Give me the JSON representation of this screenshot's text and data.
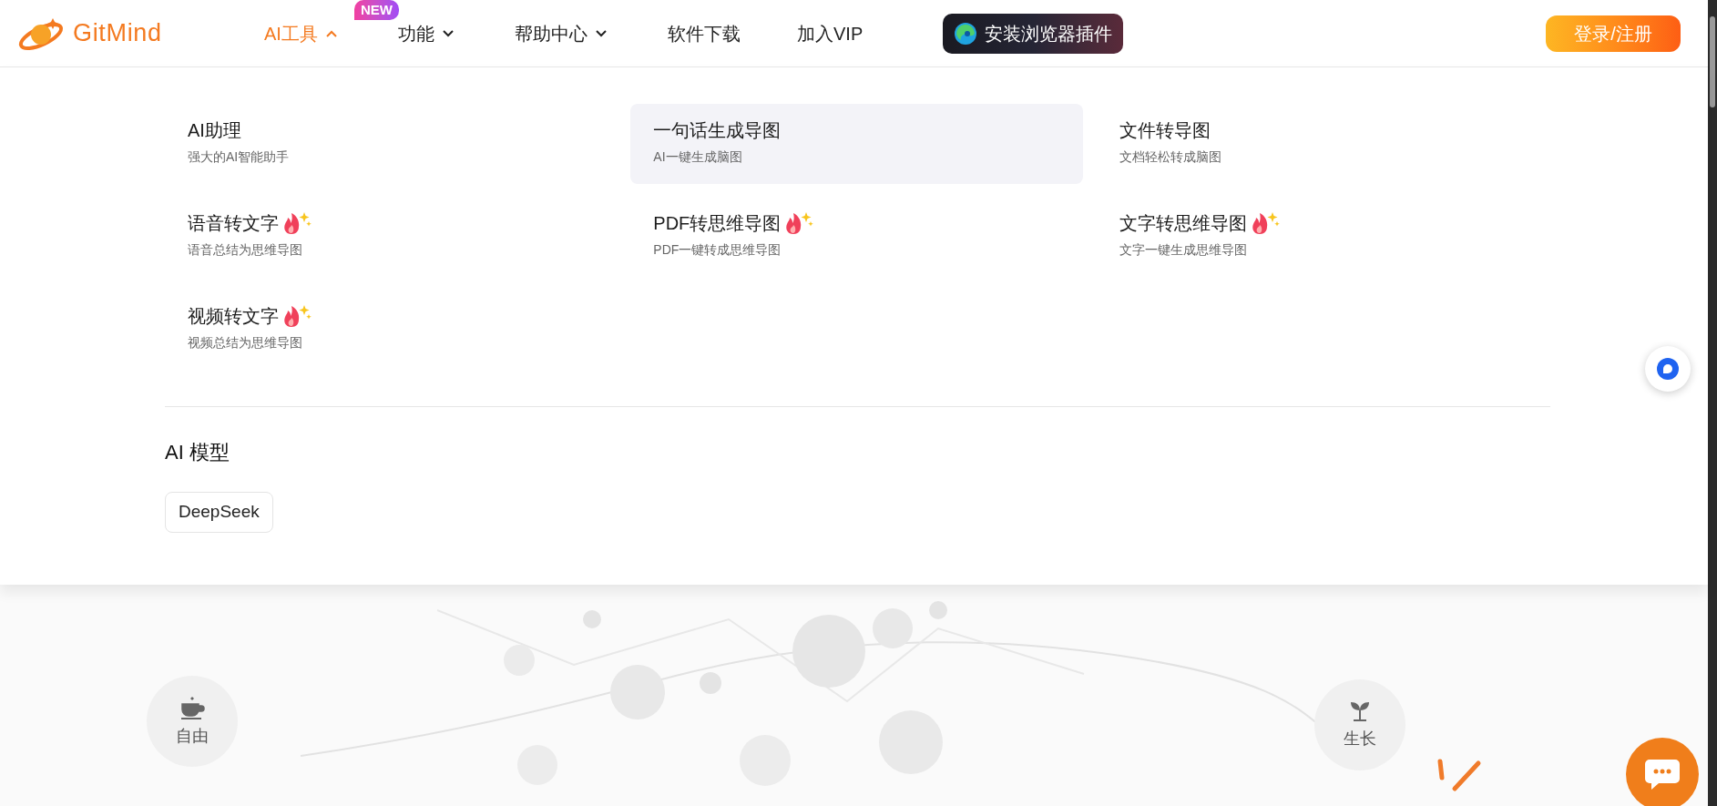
{
  "header": {
    "logo": "GitMind",
    "nav": [
      {
        "label": "AI工具",
        "kind": "dropdown",
        "selected": true,
        "expanded": true,
        "badge": "NEW"
      },
      {
        "label": "功能",
        "kind": "dropdown",
        "selected": false,
        "expanded": false
      },
      {
        "label": "帮助中心",
        "kind": "dropdown",
        "selected": false,
        "expanded": false
      },
      {
        "label": "软件下载",
        "kind": "link",
        "selected": false
      },
      {
        "label": "加入VIP",
        "kind": "link",
        "selected": false
      }
    ],
    "plugin_button": "安装浏览器插件",
    "login_button": "登录/注册"
  },
  "dropdown": {
    "items": [
      {
        "title": "AI助理",
        "subtitle": "强大的AI智能助手",
        "hot": false,
        "highlighted": false
      },
      {
        "title": "一句话生成导图",
        "subtitle": "AI一键生成脑图",
        "hot": false,
        "highlighted": true
      },
      {
        "title": "文件转导图",
        "subtitle": "文档轻松转成脑图",
        "hot": false,
        "highlighted": false
      },
      {
        "title": "语音转文字",
        "subtitle": "语音总结为思维导图",
        "hot": true,
        "highlighted": false
      },
      {
        "title": "PDF转思维导图",
        "subtitle": "PDF一键转成思维导图",
        "hot": true,
        "highlighted": false
      },
      {
        "title": "文字转思维导图",
        "subtitle": "文字一键生成思维导图",
        "hot": true,
        "highlighted": false
      },
      {
        "title": "视频转文字",
        "subtitle": "视频总结为思维导图",
        "hot": true,
        "highlighted": false
      }
    ],
    "models_heading": "AI 模型",
    "models": [
      "DeepSeek"
    ]
  },
  "hero": {
    "left_badge": "自由",
    "right_badge": "生长"
  }
}
